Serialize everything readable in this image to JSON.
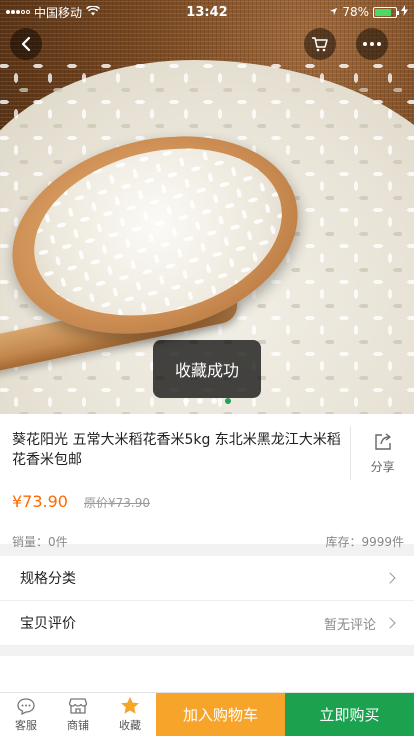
{
  "status_bar": {
    "carrier": "中国移动",
    "time": "13:42",
    "battery": "78%",
    "icons": [
      "signal-icon",
      "wifi-icon",
      "location-icon",
      "battery-icon",
      "charging-icon"
    ]
  },
  "gallery": {
    "image_alt": "rice in wooden spoon",
    "slide_count": 4,
    "active_slide": 4
  },
  "toast": {
    "text": "收藏成功"
  },
  "product": {
    "title": "葵花阳光 五常大米稻花香米5kg 东北米黑龙江大米稻花香米包邮",
    "price": "¥73.90",
    "original_price": "原价¥73.90",
    "sales": "销量：0件",
    "stock": "库存：9999件",
    "share_label": "分享"
  },
  "rows": {
    "spec_label": "规格分类",
    "review_label": "宝贝评价",
    "review_value": "暂无评论"
  },
  "bottom_bar": {
    "service_label": "客服",
    "shop_label": "商铺",
    "favorite_label": "收藏",
    "add_to_cart_label": "加入购物车",
    "buy_now_label": "立即购买"
  },
  "colors": {
    "accent_price": "#ff6a00",
    "add_to_cart_bg": "#f7a52a",
    "buy_now_bg": "#1ca24f",
    "favorite_star": "#f7a52a",
    "active_dot": "#1fa35a"
  }
}
